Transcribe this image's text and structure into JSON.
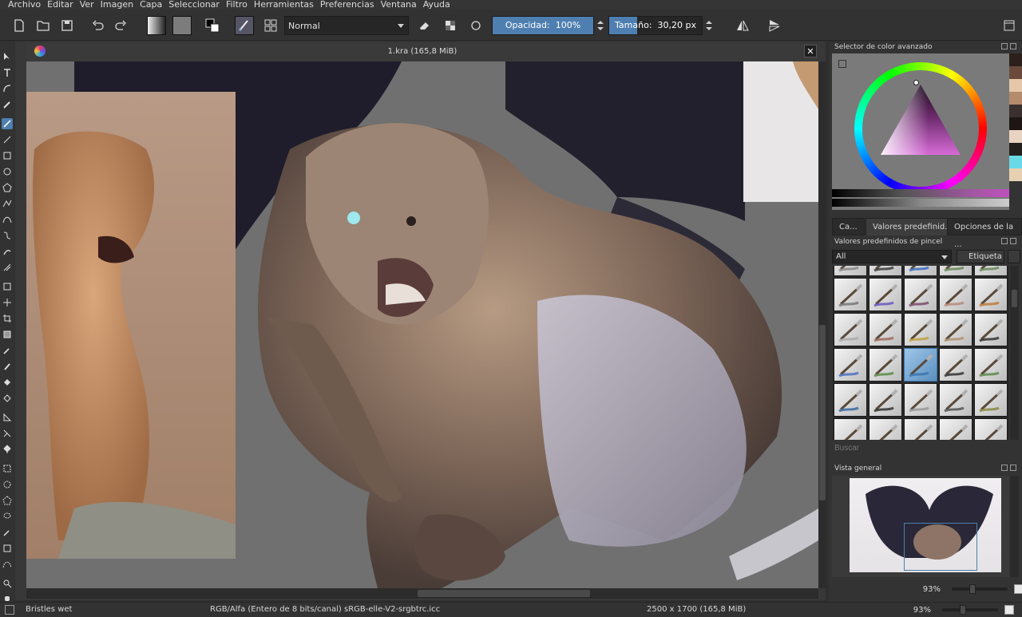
{
  "menu": [
    "Archivo",
    "Editar",
    "Ver",
    "Imagen",
    "Capa",
    "Seleccionar",
    "Filtro",
    "Herramientas",
    "Preferencias",
    "Ventana",
    "Ayuda"
  ],
  "toolbar": {
    "blend_mode": "Normal",
    "opacity_label": "Opacidad:",
    "opacity_value": "100%",
    "opacity_fraction": 1.0,
    "size_label": "Tamaño:",
    "size_value": "30,20 px",
    "size_fraction": 0.3
  },
  "document": {
    "title": "1.kra (165,8 MiB)",
    "close_glyph": "✕"
  },
  "dock": {
    "color_selector_title": "Selector de color avanzado",
    "tabs": [
      "Ca...",
      "Valores predefinid...",
      "Opciones de la ..."
    ],
    "active_tab": 1,
    "brush_presets_title": "Valores predefinidos de pincel",
    "tag_filter": "All",
    "tag_button": "Etiqueta",
    "search_placeholder": "Buscar",
    "overview_title": "Vista general",
    "zoom_values": [
      "93%",
      "93%"
    ],
    "swatch_colors": [
      "#2b201c",
      "#6b4a3c",
      "#e6c8a8",
      "#b48b6c",
      "#3a302e",
      "#1d1614",
      "#e9d3c3",
      "#23201d",
      "#6ad9e6",
      "#e6d0b0"
    ]
  },
  "status": {
    "brush": "Bristles wet",
    "color_model": "RGB/Alfa (Entero de 8 bits/canal)  sRGB-elle-V2-srgbtrc.icc",
    "dimensions": "2500 x 1700 (165,8 MiB)",
    "zoom": "93%"
  },
  "colors": {
    "accent": "#4e7fb0",
    "background": "#2f2f2f"
  }
}
